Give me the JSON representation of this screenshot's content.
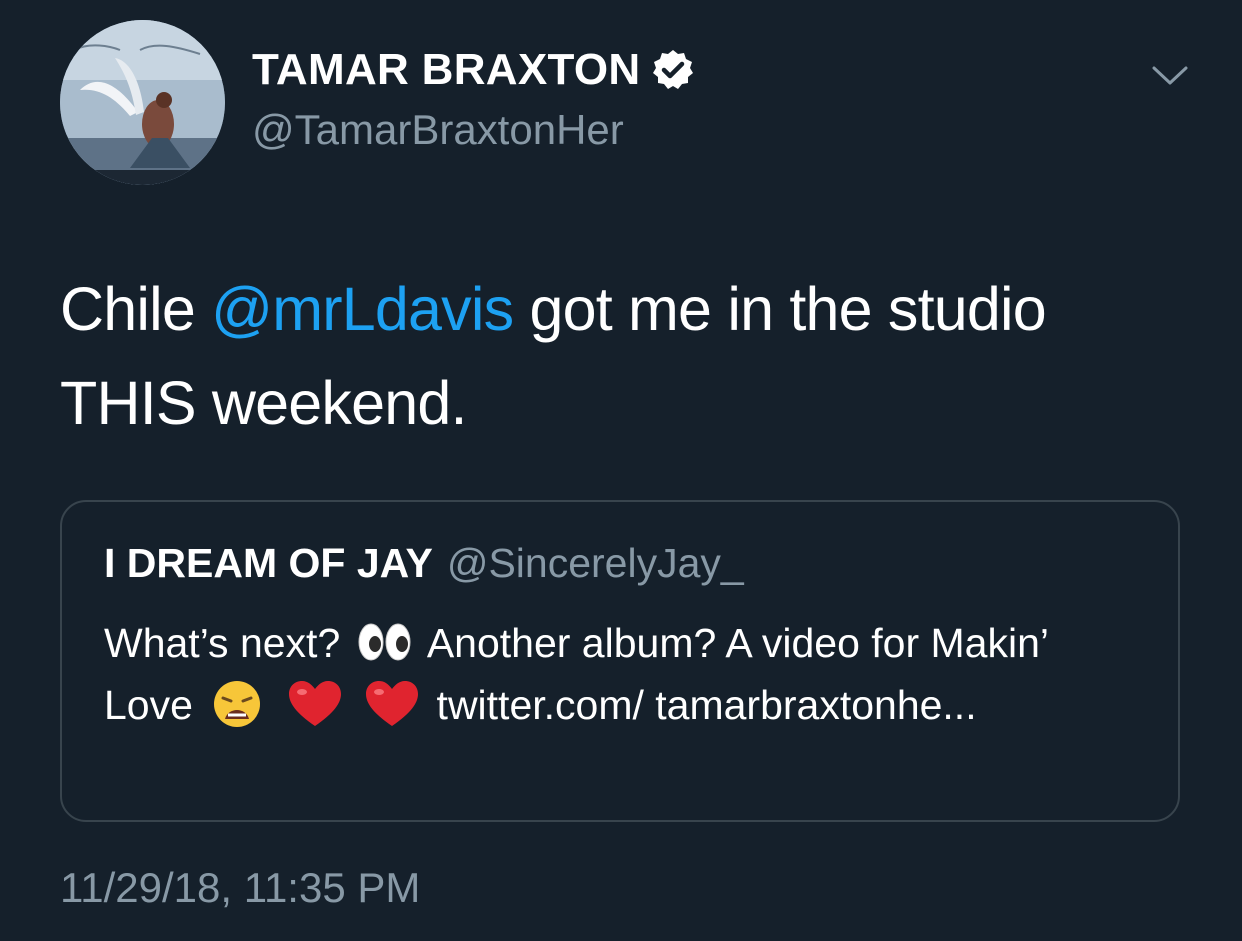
{
  "author": {
    "display_name": "TAMAR BRAXTON",
    "handle": "@TamarBraxtonHer",
    "verified": true,
    "avatar_icon": "album-art-avatar"
  },
  "menu_icon": "chevron-down-icon",
  "tweet": {
    "text_before": "Chile ",
    "mention": "@mrLdavis",
    "text_after": " got me in the studio THIS weekend."
  },
  "quoted_tweet": {
    "display_name": "I DREAM OF JAY",
    "handle": "@SincerelyJay_",
    "text_part1": "What’s next?",
    "emoji1": "eyes-emoji",
    "text_part2": "Another album? A video for Makin’ Love",
    "emoji2": "weary-face-emoji",
    "emoji3": "red-heart-emoji",
    "emoji4": "red-heart-emoji",
    "text_part3": "twitter.com/ tamarbraxtonhe..."
  },
  "timestamp": "11/29/18, 11:35 PM",
  "colors": {
    "background": "#15202b",
    "text": "#ffffff",
    "secondary_text": "#8899a6",
    "link": "#1da1f2",
    "border": "#38444d"
  }
}
